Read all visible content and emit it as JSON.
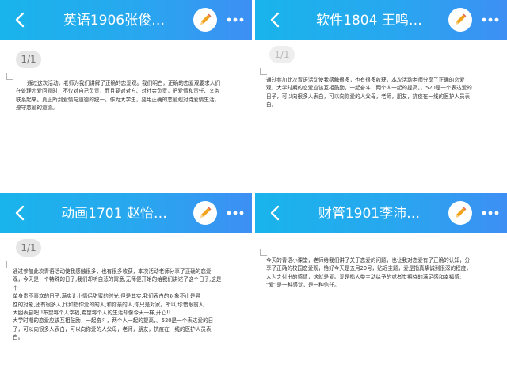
{
  "theme": {
    "header_gradient": [
      "#19b4ec",
      "#3d8ff4"
    ],
    "edit_accent": "#f2a31b"
  },
  "panels": [
    {
      "title": "英语1906张俊…",
      "page_indicator": "1/1",
      "icons": [
        "back-icon",
        "pencil-icon",
        "more-icon"
      ],
      "lines": [
        "通过这次活动，老师为我们讲解了正确的恋爱观。我们明白，正确的恋爱观要求人们",
        "在处理恋爱问题时，不仅对自己负责，而且要对对方、对社会负责，把爱情和责任、义务",
        "联系起来。真正所到爱情与道德的统一。作为大学生，要用正确的恋爱观对待爱情生活，",
        "遵守恋爱的道德。"
      ]
    },
    {
      "title": "软件1804 王鸣…",
      "page_indicator": "1/1",
      "icons": [
        "back-icon",
        "pencil-icon",
        "more-icon"
      ],
      "lines": [
        "通过参加此次青语活动使我感触很多，也有很多收获，本次活动老师分享了正确的恋爱",
        "观，大学时期的恋爱应该互相鼓励，一起奋斗，两个人一起的提高，。520是一个表达爱的",
        "日子，可以向很多人表白，可以向你爱的人父母，老师，朋友，抗疫在一线的医护人员表",
        "白。"
      ]
    },
    {
      "title": "动画1701 赵怡…",
      "page_indicator": "1/1",
      "icons": [
        "back-icon",
        "pencil-icon",
        "more-icon"
      ],
      "lines": [
        "通过参加此次青语活动使我感触很多，也有很多收获，本次活动老师分享了正确的恋爱",
        "观，今天是一个特殊的日子,我们却听自悲的寓意,无师便开始的给我们讲述了这个日子,这是",
        "个",
        "单身贵不喜欢的日子,满实让小情侣甜蜜的时光,但是其实,我们表白的对象不止是异",
        "性的对象,还有很多人,比如指你爱的的人,和你亲的人,你只是对家。所以,珍惜眼前人",
        "大胆表自吧!!布望每个人幸福,希望每个人的生活却像今天一样,开心!!",
        "大学时期的恋爱应该互相鼓励，一起奋斗，两个人一起的提高，。520是一个表达爱的日",
        "子，可以向很多人表白，可以向你爱的人父母，老师，朋友，抗疫在一线的医护人员表",
        "白。"
      ]
    },
    {
      "title": "财管1901李沛…",
      "page_indicator": "",
      "icons": [
        "back-icon",
        "pencil-icon",
        "more-icon"
      ],
      "lines": [
        "今天的青语小课堂，老师给我们讲了关于恋爱的问题，也让我对恋爱有了正确的认知，分",
        "享了正确的校园恋爱观，恰好今天是五月20号，贴近主题，爱是指真挚诚到很深的程度，",
        "人为之付出的感情，这就是爱。爱是指人类主动给予的或者觉期待的满足感和幸福感;",
        "“爱”是一种感觉，是一种信任。"
      ]
    }
  ]
}
